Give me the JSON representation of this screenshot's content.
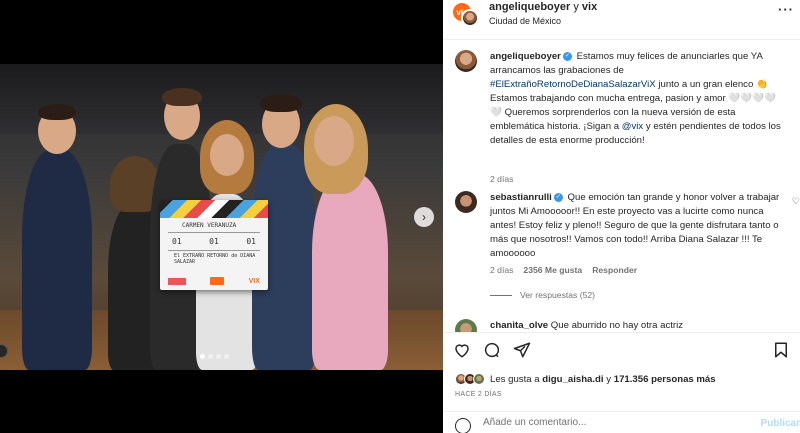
{
  "post": {
    "header": {
      "account": "angeliqueboyer",
      "joiner": "y",
      "collaborator": "vix",
      "location": "Ciudad de México",
      "vix_badge": "vix"
    },
    "clapperboard": {
      "title": "CARMEN VERANUZA",
      "scene": "01",
      "take": "01",
      "roll": "01",
      "production": "El EXTRAÑO RETORNO de DIANA SALAZAR",
      "brand": "VIX"
    },
    "carousel": {
      "total": 4,
      "active": 1
    }
  },
  "caption": {
    "user": "angeliqueboyer",
    "parts": [
      "Estamos muy felices de anunciarles que YA arrancamos las grabaciones de ",
      "#ElExtrañoRetornoDeDianaSalazarViX",
      " junto a un gran elenco 👏 Estamos trabajando con mucha entrega, pasion y amor 🤍🤍🤍🤍🤍 Queremos sorprenderlos con la nueva versión de esta emblemática historia. ¡Sigan a ",
      "@vix",
      " y estén pendientes de todos los detalles de esta enorme producción!"
    ],
    "time": "2 días"
  },
  "comments": [
    {
      "user": "sebastianrulli",
      "text": "Que emoción tan grande y honor volver a trabajar juntos Mi Amooooor!! En este proyecto vas a lucirte como nunca antes! Estoy feliz y pleno!! Seguro de que la gente disfrutara tanto o más que nosotros!! Vamos con todo!! Arriba Diana Salazar !!! Te amoooooo",
      "time": "2 días",
      "likes": "2356 Me gusta",
      "reply": "Responder",
      "view_replies": "Ver respuestas (52)"
    },
    {
      "user": "chanita_olve",
      "text": "Que aburrido no hay otra actriz"
    }
  ],
  "likes": {
    "prefix": "Les gusta a",
    "user": "digu_aisha.di",
    "middle": "y",
    "count": "171.356 personas más"
  },
  "time_ago": "HACE 2 DÍAS",
  "add_comment": {
    "placeholder": "Añade un comentario...",
    "publish": "Publicar"
  },
  "icons": {
    "more": "more-icon",
    "like": "heart-icon",
    "comment": "comment-icon",
    "share": "share-icon",
    "save": "bookmark-icon",
    "emoji": "emoji-icon",
    "next": "chevron-right-icon"
  }
}
